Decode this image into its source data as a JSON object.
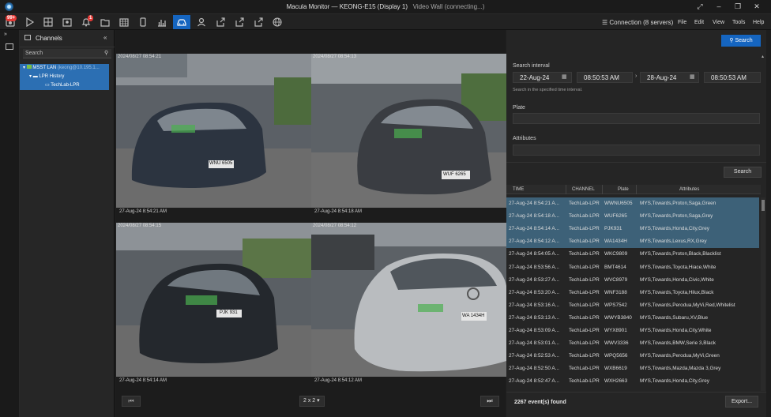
{
  "window": {
    "title": "Macula Monitor — KEONG-E15 (Display 1)",
    "subtitle": "Video Wall (connecting...)"
  },
  "toolbar": {
    "alerts_badge": "99+",
    "notif_badge": "1",
    "connection": "Connection (8 servers)",
    "menu": [
      "File",
      "Edit",
      "View",
      "Tools",
      "Help"
    ]
  },
  "channels": {
    "title": "Channels",
    "search_placeholder": "Search",
    "tree": [
      {
        "label": "MSST LAN",
        "detail": "(keong@10.195.1..."
      },
      {
        "label": "LPR History",
        "detail": ""
      },
      {
        "label": "TechLab-LPR",
        "detail": ""
      }
    ]
  },
  "wall": {
    "cameras": [
      {
        "timestamp": "2024/08/27 08:54:21",
        "caption": "27-Aug-24 8:54:21 AM",
        "plate": "WNU 6505"
      },
      {
        "timestamp": "2024/08/27 08:54:13",
        "caption": "27-Aug-24 8:54:18 AM",
        "plate": "WUF 6265"
      },
      {
        "timestamp": "2024/08/27 08:54:15",
        "caption": "27-Aug-24 8:54:14 AM",
        "plate": "PJK 931"
      },
      {
        "timestamp": "2024/08/27 08:54:12",
        "caption": "27-Aug-24 8:54:12 AM",
        "plate": "WA 1434H"
      }
    ],
    "layout": "2 x 2"
  },
  "search": {
    "button": "Search",
    "interval_label": "Search interval",
    "from_date": "22-Aug-24",
    "from_time": "08:50:53 AM",
    "to_date": "28-Aug-24",
    "to_time": "08:50:53 AM",
    "hint": "Search in the specified time interval.",
    "plate_label": "Plate",
    "attributes_label": "Attributes",
    "search_button": "Search"
  },
  "results": {
    "columns": [
      "TIME",
      "CHANNEL",
      "Plate",
      "Attributes"
    ],
    "rows": [
      {
        "time": "27-Aug-24 8:54:21 A...",
        "channel": "TechLab-LPR",
        "plate": "WWNU6505",
        "attributes": "MYS,Towards,Proton,Saga,Green",
        "selected": true
      },
      {
        "time": "27-Aug-24 8:54:18 A...",
        "channel": "TechLab-LPR",
        "plate": "WUF6265",
        "attributes": "MYS,Towards,Proton,Saga,Grey",
        "selected": true
      },
      {
        "time": "27-Aug-24 8:54:14 A...",
        "channel": "TechLab-LPR",
        "plate": "PJK931",
        "attributes": "MYS,Towards,Honda,City,Grey",
        "selected": true
      },
      {
        "time": "27-Aug-24 8:54:12 A...",
        "channel": "TechLab-LPR",
        "plate": "WA1434H",
        "attributes": "MYS,Towards,Lexus,RX,Grey",
        "selected": true
      },
      {
        "time": "27-Aug-24 8:54:05 A...",
        "channel": "TechLab-LPR",
        "plate": "WKC9809",
        "attributes": "MYS,Towards,Proton,Black,Blacklist",
        "selected": false
      },
      {
        "time": "27-Aug-24 8:53:56 A...",
        "channel": "TechLab-LPR",
        "plate": "BMT4614",
        "attributes": "MYS,Towards,Toyota,Hiace,White",
        "selected": false
      },
      {
        "time": "27-Aug-24 8:53:27 A...",
        "channel": "TechLab-LPR",
        "plate": "WVC8979",
        "attributes": "MYS,Towards,Honda,Civic,White",
        "selected": false
      },
      {
        "time": "27-Aug-24 8:53:20 A...",
        "channel": "TechLab-LPR",
        "plate": "WNF3188",
        "attributes": "MYS,Towards,Toyota,Hilux,Black",
        "selected": false
      },
      {
        "time": "27-Aug-24 8:53:16 A...",
        "channel": "TechLab-LPR",
        "plate": "WPS7542",
        "attributes": "MYS,Towards,Perodua,MyVi,Red,Whitelist",
        "selected": false
      },
      {
        "time": "27-Aug-24 8:53:13 A...",
        "channel": "TechLab-LPR",
        "plate": "WWYB3840",
        "attributes": "MYS,Towards,Subaru,XV,Blue",
        "selected": false
      },
      {
        "time": "27-Aug-24 8:53:09 A...",
        "channel": "TechLab-LPR",
        "plate": "WYX8901",
        "attributes": "MYS,Towards,Honda,City,White",
        "selected": false
      },
      {
        "time": "27-Aug-24 8:53:01 A...",
        "channel": "TechLab-LPR",
        "plate": "WWV3336",
        "attributes": "MYS,Towards,BMW,Serie 3,Black",
        "selected": false
      },
      {
        "time": "27-Aug-24 8:52:53 A...",
        "channel": "TechLab-LPR",
        "plate": "WPQ5656",
        "attributes": "MYS,Towards,Perodua,MyVi,Green",
        "selected": false
      },
      {
        "time": "27-Aug-24 8:52:50 A...",
        "channel": "TechLab-LPR",
        "plate": "WXB6619",
        "attributes": "MYS,Towards,Mazda,Mazda 3,Grey",
        "selected": false
      },
      {
        "time": "27-Aug-24 8:52:47 A...",
        "channel": "TechLab-LPR",
        "plate": "WXH2663",
        "attributes": "MYS,Towards,Honda,City,Grey",
        "selected": false
      }
    ],
    "count": "2267 event(s) found",
    "export_button": "Export..."
  },
  "colors": {
    "accent": "#1565c0",
    "selected_row": "#3d6178",
    "badge": "#e53935",
    "plate_overlay": "#4caf50"
  }
}
